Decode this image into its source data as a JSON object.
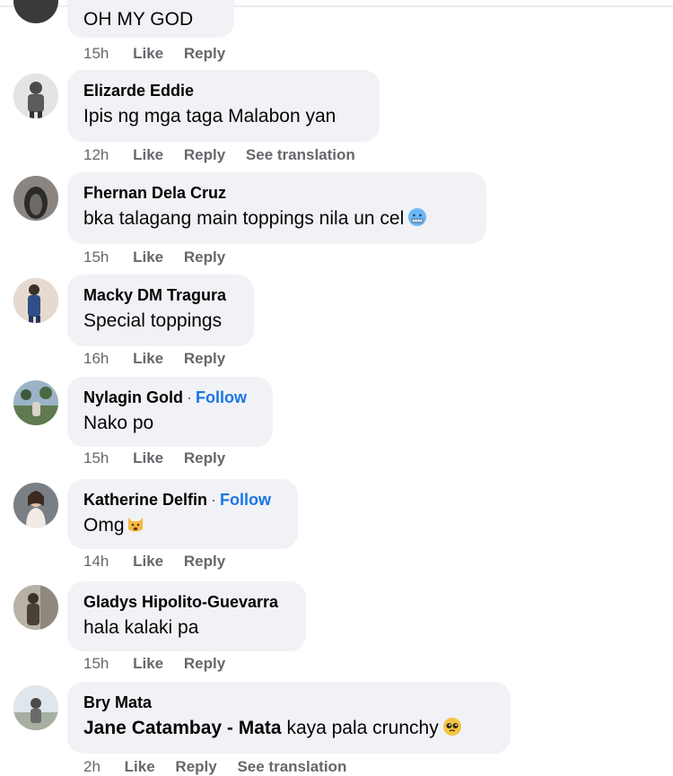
{
  "labels": {
    "like": "Like",
    "reply": "Reply",
    "see_translation": "See translation",
    "follow": "Follow",
    "separator": "·"
  },
  "comments": [
    {
      "author": "",
      "text": "OH MY GOD",
      "time": "15h",
      "translation": false,
      "follow": false
    },
    {
      "author": "Elizarde Eddie",
      "text": "Ipis ng mga taga Malabon yan",
      "time": "12h",
      "translation": true,
      "follow": false
    },
    {
      "author": "Fhernan Dela Cruz",
      "text": "bka talagang main toppings nila un cel",
      "time": "15h",
      "translation": false,
      "follow": false,
      "emoji": "cold-face-emoji"
    },
    {
      "author": "Macky DM Tragura",
      "text": "Special toppings",
      "time": "16h",
      "translation": false,
      "follow": false
    },
    {
      "author": "Nylagin Gold",
      "text": "Nako po",
      "time": "15h",
      "translation": false,
      "follow": true
    },
    {
      "author": "Katherine Delfin",
      "text": "Omg",
      "time": "14h",
      "translation": false,
      "follow": true,
      "emoji": "weary-cat-emoji"
    },
    {
      "author": "Gladys Hipolito-Guevarra",
      "text": "hala kalaki pa",
      "time": "15h",
      "translation": false,
      "follow": false
    },
    {
      "author": "Bry Mata",
      "mention": "Jane Catambay - Mata",
      "text": "kaya pala crunchy",
      "time": "2h",
      "translation": true,
      "follow": false,
      "emoji": "pleading-face-emoji"
    }
  ]
}
